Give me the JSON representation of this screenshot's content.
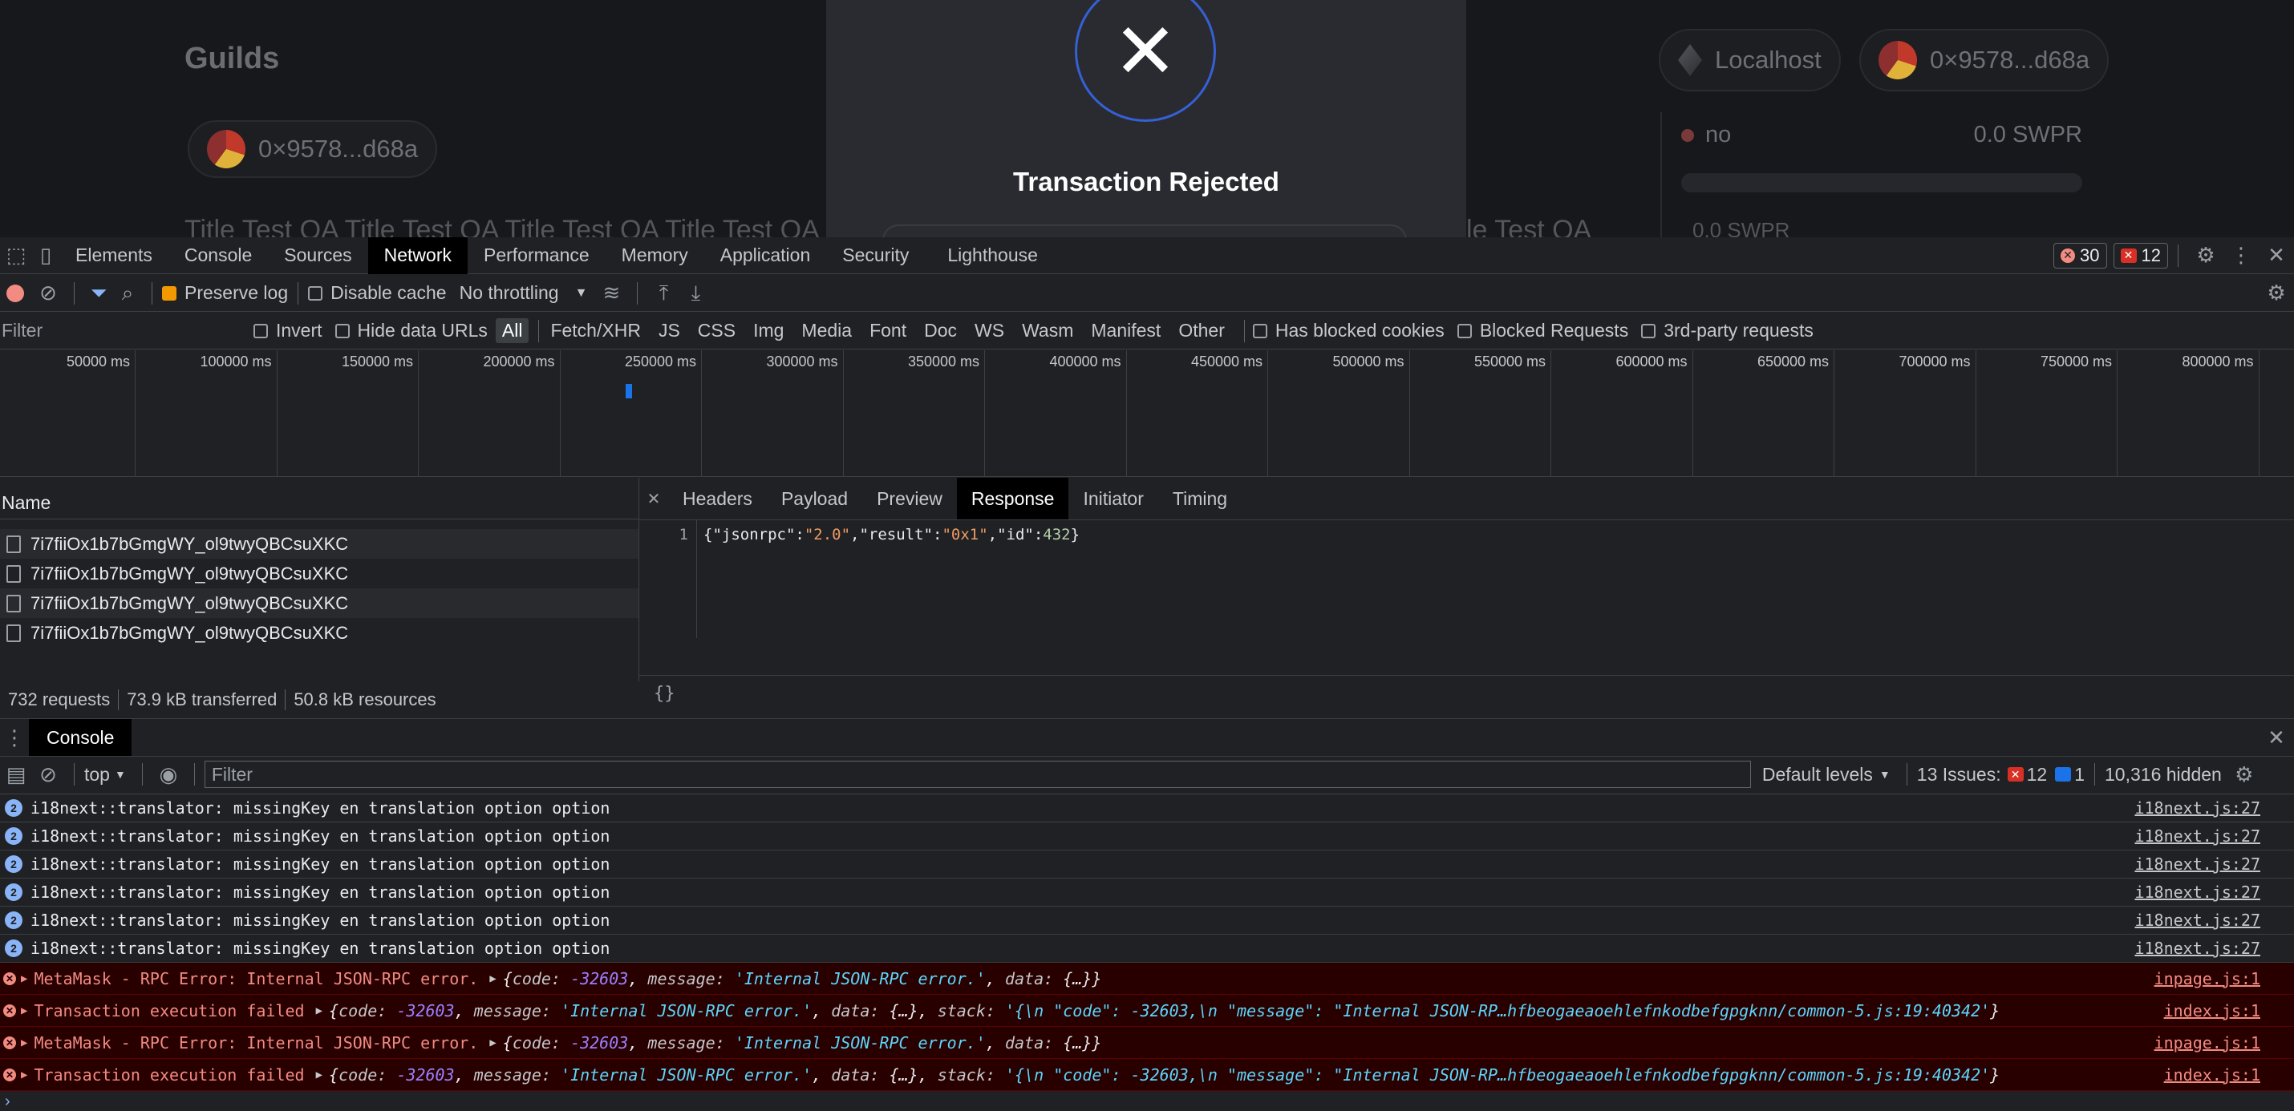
{
  "app": {
    "title": "Guilds",
    "wallet_short": "0×9578...d68a",
    "network": "Localhost",
    "title_strip": "Title Test QA  Title Test QA  Title Test QA  Title Test QA",
    "title_strip_right": "le Test QA",
    "stat_label": "no",
    "stat_value": "0.0 SWPR",
    "stat_below": "0.0 SWPR"
  },
  "modal": {
    "title": "Transaction Rejected"
  },
  "devtools": {
    "tabs": [
      "Elements",
      "Console",
      "Sources",
      "Network",
      "Performance",
      "Memory",
      "Application",
      "Security",
      "Lighthouse"
    ],
    "active_tab": "Network",
    "error_count": "30",
    "issue_count": "12",
    "toolbar": {
      "preserve_log": "Preserve log",
      "disable_cache": "Disable cache",
      "throttling": "No throttling"
    },
    "filter": {
      "placeholder": "Filter",
      "invert": "Invert",
      "hide_data_urls": "Hide data URLs",
      "types": [
        "All",
        "Fetch/XHR",
        "JS",
        "CSS",
        "Img",
        "Media",
        "Font",
        "Doc",
        "WS",
        "Wasm",
        "Manifest",
        "Other"
      ],
      "active_type": "All",
      "has_blocked_cookies": "Has blocked cookies",
      "blocked_requests": "Blocked Requests",
      "third_party": "3rd-party requests"
    },
    "timeline_ticks": [
      "50000 ms",
      "100000 ms",
      "150000 ms",
      "200000 ms",
      "250000 ms",
      "300000 ms",
      "350000 ms",
      "400000 ms",
      "450000 ms",
      "500000 ms",
      "550000 ms",
      "600000 ms",
      "650000 ms",
      "700000 ms",
      "750000 ms",
      "800000 ms"
    ],
    "requests": {
      "name_header": "Name",
      "items": [
        "7i7fiiOx1b7bGmgWY_ol9twyQBCsuXKC",
        "7i7fiiOx1b7bGmgWY_ol9twyQBCsuXKC",
        "7i7fiiOx1b7bGmgWY_ol9twyQBCsuXKC",
        "7i7fiiOx1b7bGmgWY_ol9twyQBCsuXKC"
      ]
    },
    "status": {
      "requests": "732 requests",
      "transferred": "73.9 kB transferred",
      "resources": "50.8 kB resources"
    },
    "detail": {
      "tabs": [
        "Headers",
        "Payload",
        "Preview",
        "Response",
        "Initiator",
        "Timing"
      ],
      "active_tab": "Response",
      "line_number": "1",
      "response": {
        "p1": "{\"jsonrpc\":",
        "v1": "\"2.0\"",
        "p2": ",\"result\":",
        "v2": "\"0x1\"",
        "p3": ",\"id\":",
        "v3": "432",
        "p4": "}"
      },
      "pretty_print": "{}"
    },
    "console": {
      "tab": "Console",
      "context": "top",
      "filter_placeholder": "Filter",
      "levels": "Default levels",
      "issues_label": "13 Issues:",
      "issues_errors": "12",
      "issues_info": "1",
      "hidden": "10,316 hidden",
      "info_rows": [
        {
          "count": "2",
          "text": "i18next::translator: missingKey en translation option  option",
          "source": "i18next.js:27"
        },
        {
          "count": "2",
          "text": "i18next::translator: missingKey en translation option  option",
          "source": "i18next.js:27"
        },
        {
          "count": "2",
          "text": "i18next::translator: missingKey en translation option  option",
          "source": "i18next.js:27"
        },
        {
          "count": "2",
          "text": "i18next::translator: missingKey en translation option  option",
          "source": "i18next.js:27"
        },
        {
          "count": "2",
          "text": "i18next::translator: missingKey en translation option  option",
          "source": "i18next.js:27"
        },
        {
          "count": "2",
          "text": "i18next::translator: missingKey en translation option  option",
          "source": "i18next.js:27"
        }
      ],
      "error_rows": [
        {
          "prefix": "MetaMask - RPC Error: Internal JSON-RPC error.",
          "code": "-32603",
          "message": "'Internal JSON-RPC error.'",
          "data": "{…}",
          "stack": "",
          "source": "inpage.js:1"
        },
        {
          "prefix": "Transaction execution failed",
          "code": "-32603",
          "message": "'Internal JSON-RPC error.'",
          "data": "{…}",
          "stack": "'{\\n  \"code\": -32603,\\n  \"message\": \"Internal JSON-RP…hfbeogaeaoehlefnkodbefgpgknn/common-5.js:19:40342'",
          "source": "index.js:1"
        },
        {
          "prefix": "MetaMask - RPC Error: Internal JSON-RPC error.",
          "code": "-32603",
          "message": "'Internal JSON-RPC error.'",
          "data": "{…}",
          "stack": "",
          "source": "inpage.js:1"
        },
        {
          "prefix": "Transaction execution failed",
          "code": "-32603",
          "message": "'Internal JSON-RPC error.'",
          "data": "{…}",
          "stack": "'{\\n  \"code\": -32603,\\n  \"message\": \"Internal JSON-RP…hfbeogaeaoehlefnkodbefgpgknn/common-5.js:19:40342'",
          "source": "index.js:1"
        }
      ]
    }
  }
}
